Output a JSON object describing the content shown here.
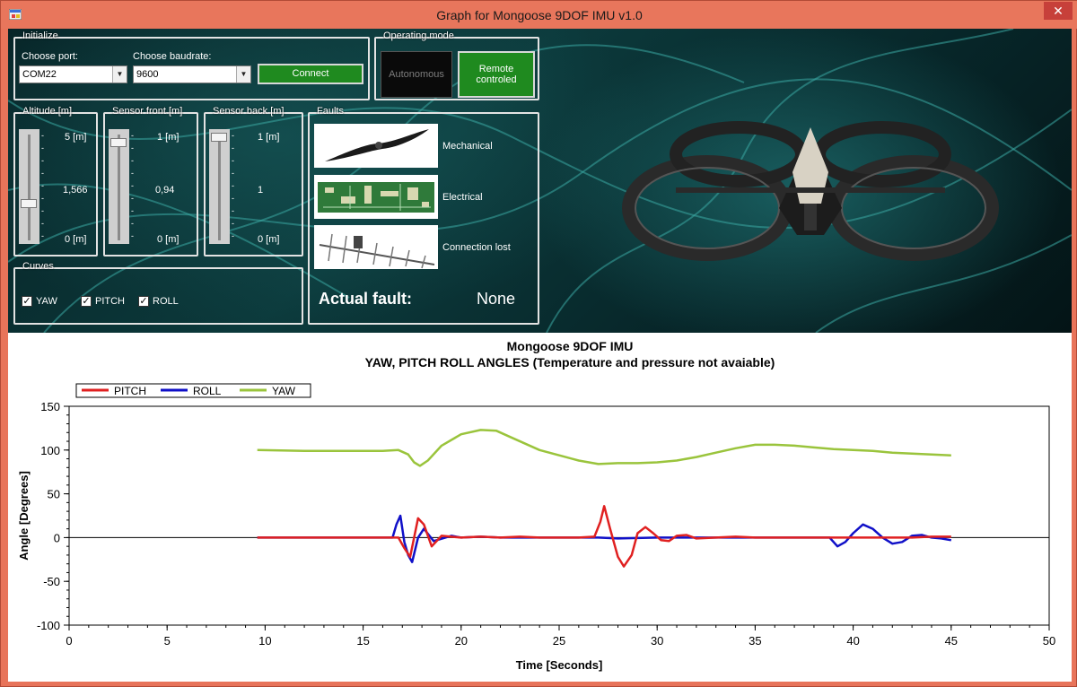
{
  "window": {
    "title": "Graph for Mongoose 9DOF IMU v1.0",
    "close_glyph": "✕"
  },
  "initialize": {
    "legend": "Initialize",
    "port_label": "Choose port:",
    "port_value": "COM22",
    "baud_label": "Choose baudrate:",
    "baud_value": "9600",
    "connect_label": "Connect"
  },
  "operating_mode": {
    "legend": "Operating mode",
    "autonomous_label": "Autonomous",
    "remote_label_line1": "Remote",
    "remote_label_line2": "controled"
  },
  "altitude": {
    "legend": "Altitude [m]",
    "max": "5 [m]",
    "value": "1,566",
    "min": "0 [m]",
    "level": 0.313
  },
  "sensor_front": {
    "legend": "Sensor front [m]",
    "max": "1 [m]",
    "value": "0,94",
    "min": "0 [m]",
    "level": 0.94
  },
  "sensor_back": {
    "legend": "Sensor back [m]",
    "max": "1 [m]",
    "value": "1",
    "min": "0 [m]",
    "level": 1.0
  },
  "faults": {
    "legend": "Faults",
    "items": [
      "Mechanical",
      "Electrical",
      "Connection lost"
    ],
    "actual_label": "Actual fault:",
    "actual_value": "None"
  },
  "curves": {
    "legend": "Curves",
    "items": [
      {
        "label": "YAW",
        "checked": true
      },
      {
        "label": "PITCH",
        "checked": true
      },
      {
        "label": "ROLL",
        "checked": true
      }
    ]
  },
  "colors": {
    "pitch": "#e02020",
    "roll": "#1010c8",
    "yaw": "#9ac43c",
    "accent_green": "#1f8a1f"
  },
  "chart_data": {
    "type": "line",
    "title": "Mongoose 9DOF IMU",
    "subtitle": "YAW, PITCH ROLL ANGLES (Temperature and pressure not avaiable)",
    "xlabel": "Time [Seconds]",
    "ylabel": "Angle [Degrees]",
    "xlim": [
      0,
      50
    ],
    "ylim": [
      -100,
      150
    ],
    "x_ticks": [
      "0",
      "5",
      "10",
      "15",
      "20",
      "25",
      "30",
      "35",
      "40",
      "45",
      "50"
    ],
    "y_ticks": [
      "150",
      "100",
      "50",
      "0",
      "-50",
      "-100"
    ],
    "legend_position": "top-left",
    "series": [
      {
        "name": "PITCH",
        "color": "#e02020",
        "x": [
          9.6,
          16.5,
          16.8,
          17.1,
          17.4,
          17.8,
          18.1,
          18.5,
          19.0,
          20,
          21,
          22,
          23,
          24,
          25,
          26,
          26.8,
          27.1,
          27.3,
          27.6,
          28.0,
          28.3,
          28.7,
          29.0,
          29.4,
          29.8,
          30.2,
          30.6,
          31.0,
          31.5,
          32,
          33,
          34,
          35,
          36,
          37,
          38,
          39,
          40,
          41,
          42,
          43,
          44,
          45
        ],
        "y": [
          0,
          0,
          0,
          -12,
          -22,
          22,
          15,
          -10,
          2,
          0,
          1,
          0,
          1,
          0,
          0,
          0,
          1,
          18,
          36,
          10,
          -22,
          -33,
          -20,
          5,
          12,
          5,
          -3,
          -4,
          2,
          3,
          -1,
          0,
          1,
          0,
          0,
          0,
          0,
          0,
          0,
          0,
          0,
          0,
          1,
          1
        ]
      },
      {
        "name": "ROLL",
        "color": "#1010c8",
        "x": [
          9.6,
          16.5,
          16.7,
          16.9,
          17.1,
          17.3,
          17.5,
          17.8,
          18.1,
          18.6,
          19.5,
          20,
          21,
          22,
          25,
          27,
          28,
          30,
          33,
          36,
          38,
          38.8,
          39.2,
          39.6,
          40.0,
          40.5,
          41.0,
          41.5,
          42,
          42.5,
          43,
          43.5,
          44,
          44.5,
          45
        ],
        "y": [
          0,
          0,
          15,
          25,
          -5,
          -20,
          -28,
          0,
          10,
          -4,
          2,
          0,
          1,
          0,
          0,
          0,
          -1,
          0,
          0,
          0,
          0,
          0,
          -10,
          -5,
          5,
          15,
          10,
          0,
          -7,
          -5,
          2,
          3,
          0,
          -1,
          -3
        ]
      },
      {
        "name": "YAW",
        "color": "#9ac43c",
        "x": [
          9.6,
          12,
          14,
          16,
          16.8,
          17.3,
          17.6,
          17.9,
          18.3,
          19,
          20,
          21,
          21.8,
          22.5,
          24,
          26,
          27,
          28,
          29,
          30,
          31,
          32,
          33,
          34,
          35,
          36,
          37,
          38,
          39,
          40,
          41,
          42,
          43,
          44,
          45
        ],
        "y": [
          100,
          99,
          99,
          99,
          100,
          95,
          86,
          82,
          88,
          105,
          118,
          123,
          122,
          115,
          100,
          88,
          84,
          85,
          85,
          86,
          88,
          92,
          97,
          102,
          106,
          106,
          105,
          103,
          101,
          100,
          99,
          97,
          96,
          95,
          94
        ]
      }
    ]
  }
}
